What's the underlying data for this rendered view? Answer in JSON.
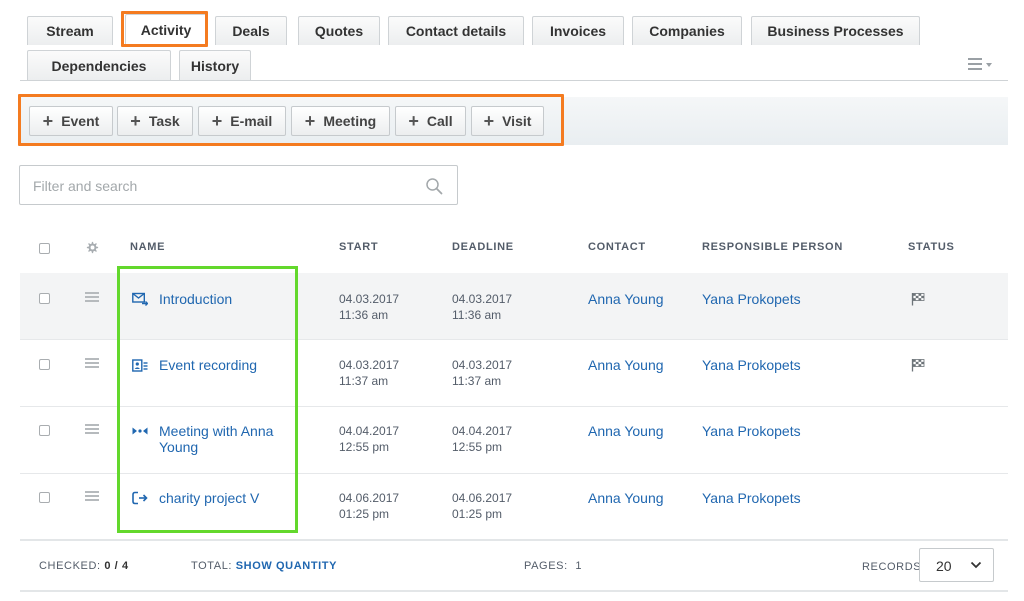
{
  "tabs": [
    {
      "label": "Stream"
    },
    {
      "label": "Activity"
    },
    {
      "label": "Deals"
    },
    {
      "label": "Quotes"
    },
    {
      "label": "Contact details"
    },
    {
      "label": "Invoices"
    },
    {
      "label": "Companies"
    },
    {
      "label": "Business Processes"
    },
    {
      "label": "Dependencies"
    },
    {
      "label": "History"
    }
  ],
  "toolbar": {
    "buttons": [
      {
        "label": "Event"
      },
      {
        "label": "Task"
      },
      {
        "label": "E-mail"
      },
      {
        "label": "Meeting"
      },
      {
        "label": "Call"
      },
      {
        "label": "Visit"
      }
    ]
  },
  "filter": {
    "placeholder": "Filter and search",
    "value": ""
  },
  "table": {
    "headers": {
      "name": "NAME",
      "start": "START",
      "deadline": "DEADLINE",
      "contact": "CONTACT",
      "responsible": "RESPONSIBLE PERSON",
      "status": "STATUS"
    },
    "rows": [
      {
        "icon": "email-icon",
        "name": "Introduction",
        "start_date": "04.03.2017",
        "start_time": "11:36 am",
        "deadline_date": "04.03.2017",
        "deadline_time": "11:36 am",
        "contact": "Anna Young",
        "responsible": "Yana Prokopets",
        "status": "checkered-flag-icon"
      },
      {
        "icon": "event-card-icon",
        "name": "Event recording",
        "start_date": "04.03.2017",
        "start_time": "11:37 am",
        "deadline_date": "04.03.2017",
        "deadline_time": "11:37 am",
        "contact": "Anna Young",
        "responsible": "Yana Prokopets",
        "status": "checkered-flag-icon"
      },
      {
        "icon": "meeting-icon",
        "name_line1": "Meeting with Anna",
        "name_line2": "Young",
        "start_date": "04.04.2017",
        "start_time": "12:55 pm",
        "deadline_date": "04.04.2017",
        "deadline_time": "12:55 pm",
        "contact": "Anna Young",
        "responsible": "Yana Prokopets",
        "status": ""
      },
      {
        "icon": "call-icon",
        "name": "charity project V",
        "start_date": "04.06.2017",
        "start_time": "01:25 pm",
        "deadline_date": "04.06.2017",
        "deadline_time": "01:25 pm",
        "contact": "Anna Young",
        "responsible": "Yana Prokopets",
        "status": ""
      }
    ]
  },
  "footer": {
    "checked_label": "CHECKED:",
    "checked_value": "0 / 4",
    "total_label": "TOTAL:",
    "total_link": "SHOW QUANTITY",
    "pages_label": "PAGES:",
    "pages_value": "1",
    "records_label": "RECORDS:",
    "records_value": "20"
  },
  "colors": {
    "link": "#2067b0",
    "highlight_orange": "#f47b20",
    "highlight_green": "#63d82c",
    "header_text": "#535c69"
  }
}
